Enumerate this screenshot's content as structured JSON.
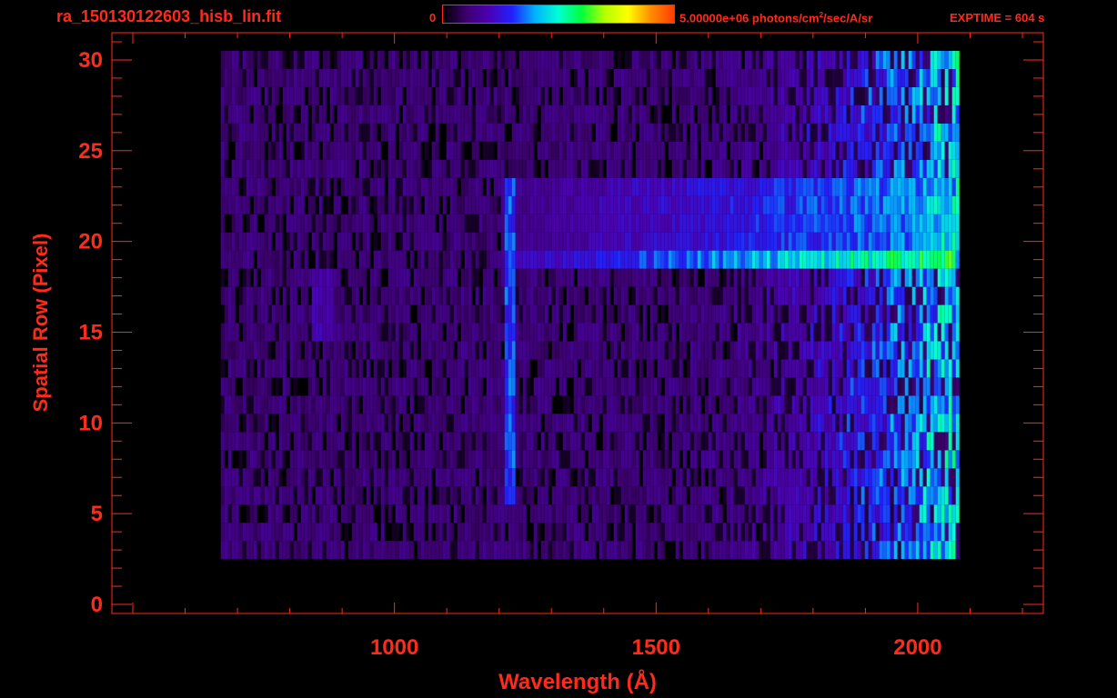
{
  "header": {
    "file_title": "ra_150130122603_hisb_lin.fit",
    "colorbar_min": "0",
    "colorbar_max_pre": "5.00000e+06 photons/cm",
    "colorbar_max_sup": "2",
    "colorbar_max_post": "/sec/A/sr",
    "exptime": "EXPTIME = 604 s"
  },
  "colors": {
    "axis": "#ff2a1a",
    "background": "#000000",
    "colormap": [
      "#000000",
      "#3c006e",
      "#4b00b4",
      "#2020ff",
      "#00b4ff",
      "#00ffd2",
      "#00ff3c",
      "#b4ff00",
      "#ffff00",
      "#ff8c00",
      "#ff3c00"
    ]
  },
  "chart_data": {
    "type": "heatmap",
    "title": "ra_150130122603_hisb_lin.fit",
    "xlabel": "Wavelength (Å)",
    "ylabel": "Spatial Row (Pixel)",
    "xlim": [
      460,
      2240
    ],
    "ylim": [
      -0.5,
      31.5
    ],
    "x_ticks": [
      1000,
      1500,
      2000
    ],
    "y_ticks": [
      0,
      5,
      10,
      15,
      20,
      25,
      30
    ],
    "x_minor_step": 100,
    "y_minor_step": 1,
    "colorbar": {
      "min": 0,
      "max": 5000000,
      "units": "photons/cm^2/sec/A/sr"
    },
    "data_extent": {
      "x": [
        668,
        2075
      ],
      "rows": [
        3,
        30
      ]
    },
    "features": [
      {
        "name": "bright band",
        "x": [
          1210,
          2070
        ],
        "rows": [
          19,
          19
        ],
        "level": 0.62
      },
      {
        "name": "upper band",
        "x": [
          1200,
          2070
        ],
        "rows": [
          20,
          23
        ],
        "level": 0.42
      },
      {
        "name": "emission line",
        "x": [
          1205,
          1225
        ],
        "rows": [
          6,
          23
        ],
        "level": 0.35
      },
      {
        "name": "faint feature",
        "x": [
          835,
          880
        ],
        "rows": [
          15,
          18
        ],
        "level": 0.2
      }
    ],
    "grid": false
  }
}
